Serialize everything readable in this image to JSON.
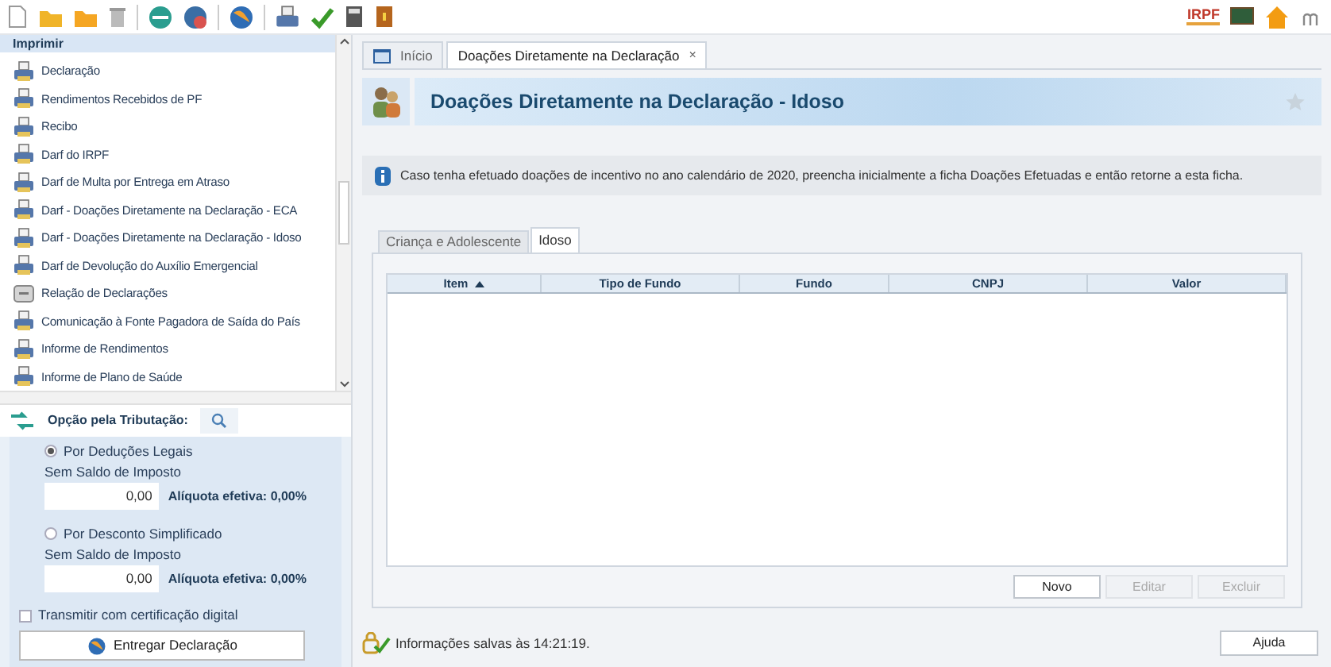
{
  "toolbar": {
    "logo_text": "IRPF"
  },
  "sidebar": {
    "title": "Imprimir",
    "items": [
      {
        "label": "Declaração",
        "kind": "printer"
      },
      {
        "label": "Rendimentos Recebidos de PF",
        "kind": "printer"
      },
      {
        "label": "Recibo",
        "kind": "printer"
      },
      {
        "label": "Darf do IRPF",
        "kind": "printer"
      },
      {
        "label": "Darf de Multa por Entrega em Atraso",
        "kind": "printer"
      },
      {
        "label": "Darf - Doações Diretamente na Declaração - ECA",
        "kind": "printer"
      },
      {
        "label": "Darf - Doações Diretamente na Declaração - Idoso",
        "kind": "printer"
      },
      {
        "label": "Darf de Devolução do Auxílio Emergencial",
        "kind": "printer"
      },
      {
        "label": "Relação de Declarações",
        "kind": "document"
      },
      {
        "label": "Comunicação à Fonte Pagadora de Saída do País",
        "kind": "printer"
      },
      {
        "label": "Informe de Rendimentos",
        "kind": "printer"
      },
      {
        "label": "Informe de Plano de Saúde",
        "kind": "printer"
      }
    ]
  },
  "taxation": {
    "title": "Opção pela Tributação:",
    "options": [
      {
        "label": "Por Deduções Legais",
        "selected": true,
        "note": "Sem Saldo de Imposto",
        "value": "0,00",
        "rate": "Alíquota efetiva: 0,00%"
      },
      {
        "label": "Por Desconto Simplificado",
        "selected": false,
        "note": "Sem Saldo de Imposto",
        "value": "0,00",
        "rate": "Alíquota efetiva: 0,00%"
      }
    ],
    "certificate": {
      "label": "Transmitir com certificação digital",
      "checked": false
    },
    "submit": "Entregar Declaração"
  },
  "tabs": [
    {
      "label": "Início",
      "selected": false,
      "closable": false
    },
    {
      "label": "Doações Diretamente na Declaração",
      "selected": true,
      "closable": true,
      "close": "×"
    }
  ],
  "page": {
    "title": "Doações Diretamente na Declaração - Idoso",
    "info": "Caso tenha efetuado doações de incentivo no ano calendário de 2020, preencha inicialmente a ficha Doações Efetuadas e então retorne a esta ficha.",
    "subtabs": [
      {
        "label": "Criança e Adolescente",
        "selected": false
      },
      {
        "label": "Idoso",
        "selected": true
      }
    ],
    "table": {
      "columns": [
        {
          "label": "Item",
          "sorted": true
        },
        {
          "label": "Tipo de Fundo",
          "sorted": false
        },
        {
          "label": "Fundo",
          "sorted": false
        },
        {
          "label": "CNPJ",
          "sorted": false
        },
        {
          "label": "Valor",
          "sorted": false
        }
      ]
    },
    "buttons": [
      {
        "label": "Novo",
        "disabled": false
      },
      {
        "label": "Editar",
        "disabled": true
      },
      {
        "label": "Excluir",
        "disabled": true
      }
    ]
  },
  "status": {
    "message": "Informações salvas às 14:21:19.",
    "help": "Ajuda"
  }
}
